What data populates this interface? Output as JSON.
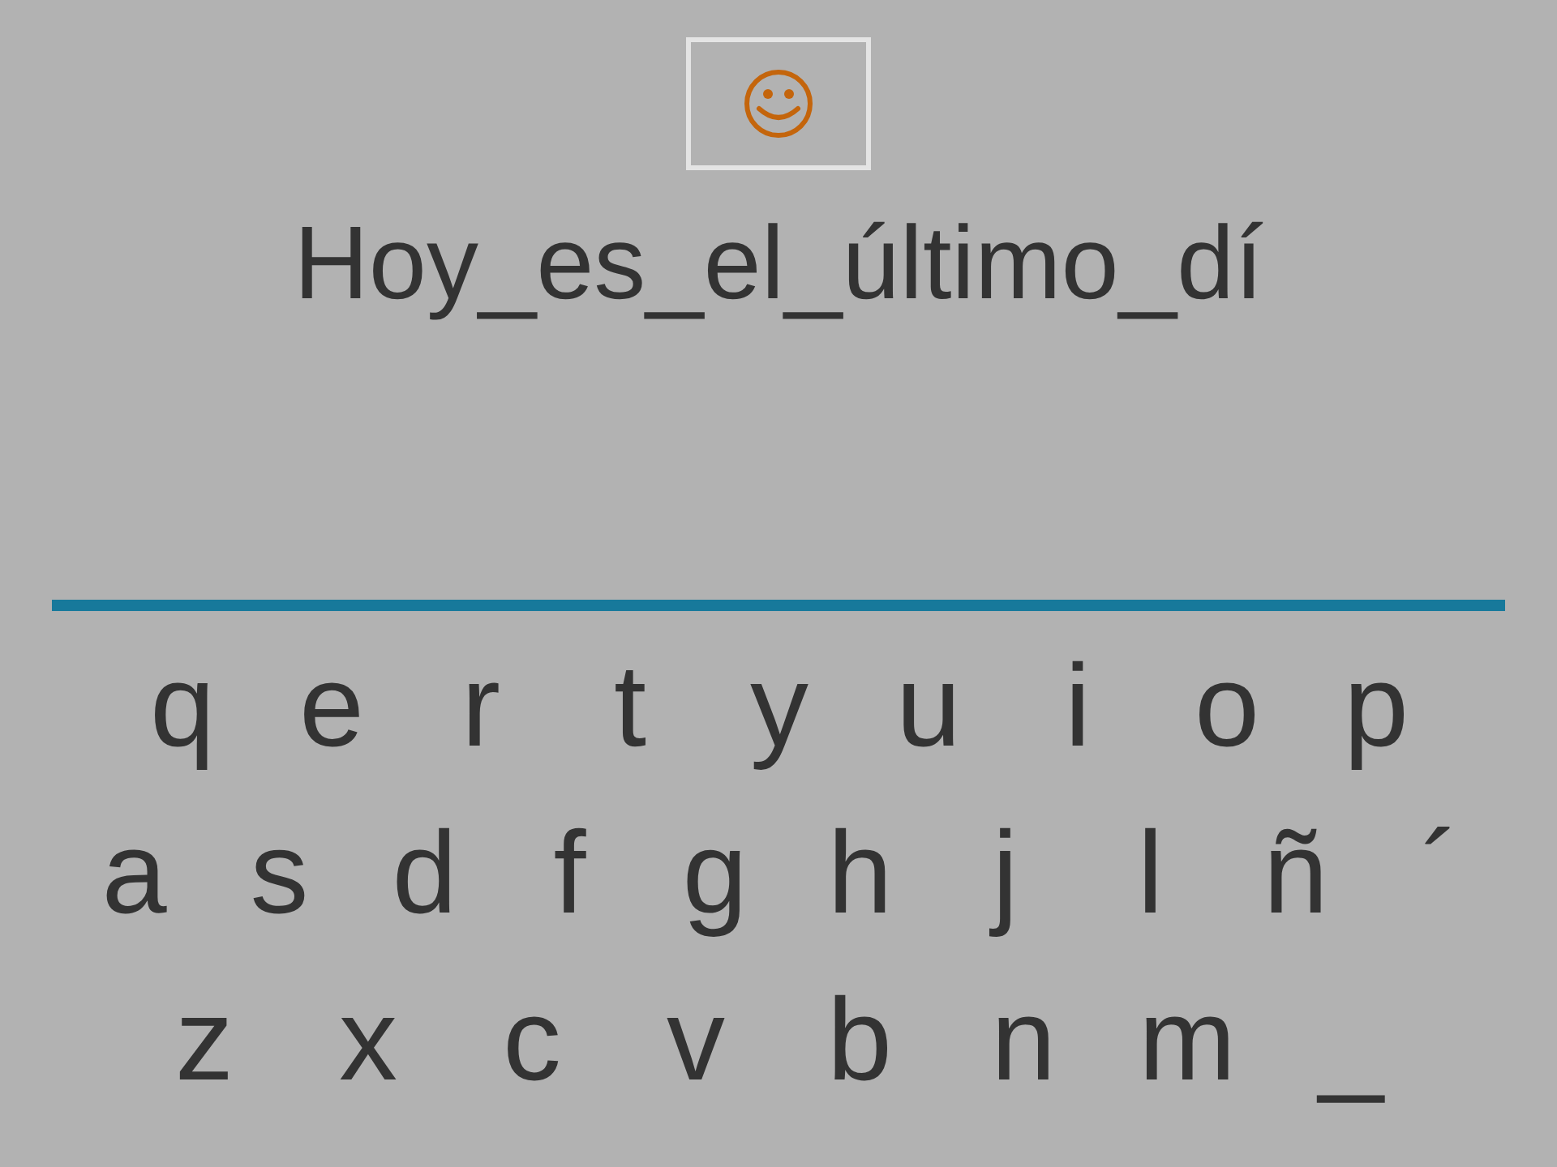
{
  "sentence": "Hoy_es_el_último_dí",
  "keyboard": {
    "rows": [
      [
        "q",
        "e",
        "r",
        "t",
        "y",
        "u",
        "i",
        "o",
        "p"
      ],
      [
        "a",
        "s",
        "d",
        "f",
        "g",
        "h",
        "j",
        "l",
        "ñ",
        "´"
      ],
      [
        "z",
        "x",
        "c",
        "v",
        "b",
        "n",
        "m",
        "_"
      ]
    ]
  }
}
